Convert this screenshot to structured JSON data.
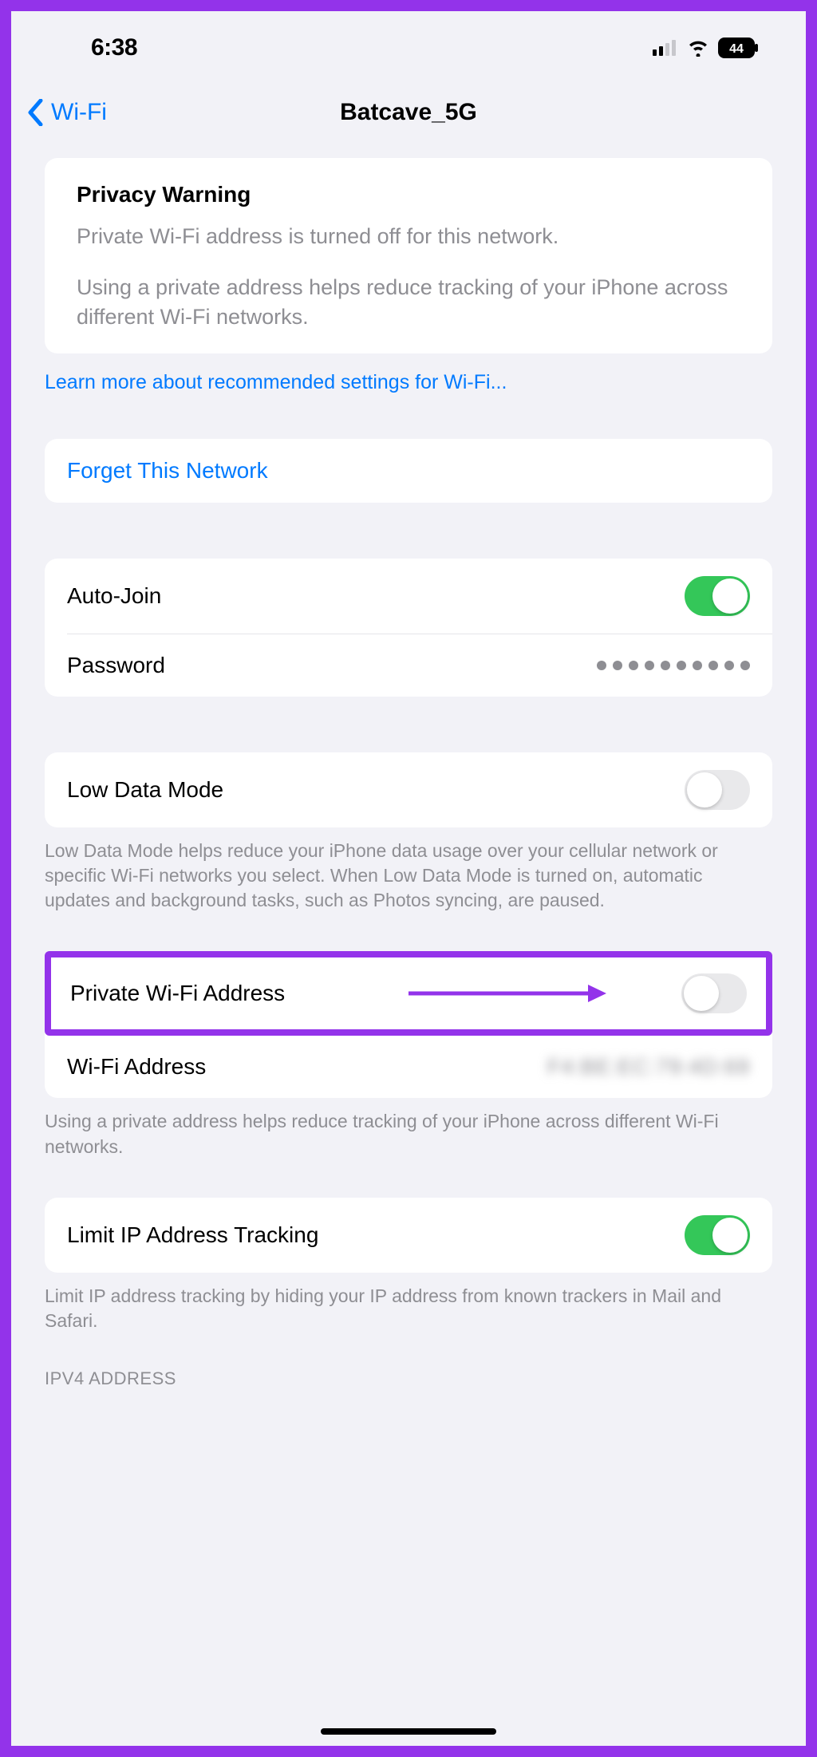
{
  "status": {
    "time": "6:38",
    "battery": "44"
  },
  "nav": {
    "back_label": "Wi-Fi",
    "title": "Batcave_5G"
  },
  "privacy": {
    "title": "Privacy Warning",
    "line1": "Private Wi-Fi address is turned off for this network.",
    "line2": "Using a private address helps reduce tracking of your iPhone across different Wi-Fi networks."
  },
  "learn_more": "Learn more about recommended settings for Wi-Fi...",
  "forget": "Forget This Network",
  "auto_join": {
    "label": "Auto-Join"
  },
  "password": {
    "label": "Password"
  },
  "low_data": {
    "label": "Low Data Mode",
    "footer": "Low Data Mode helps reduce your iPhone data usage over your cellular network or specific Wi-Fi networks you select. When Low Data Mode is turned on, automatic updates and background tasks, such as Photos syncing, are paused."
  },
  "private_wifi": {
    "label": "Private Wi-Fi Address"
  },
  "wifi_address": {
    "label": "Wi-Fi Address",
    "value": "F4:BE:EC:79:4D:69"
  },
  "private_footer": "Using a private address helps reduce tracking of your iPhone across different Wi-Fi networks.",
  "limit_ip": {
    "label": "Limit IP Address Tracking",
    "footer": "Limit IP address tracking by hiding your IP address from known trackers in Mail and Safari."
  },
  "ipv4_header": "IPV4 ADDRESS"
}
